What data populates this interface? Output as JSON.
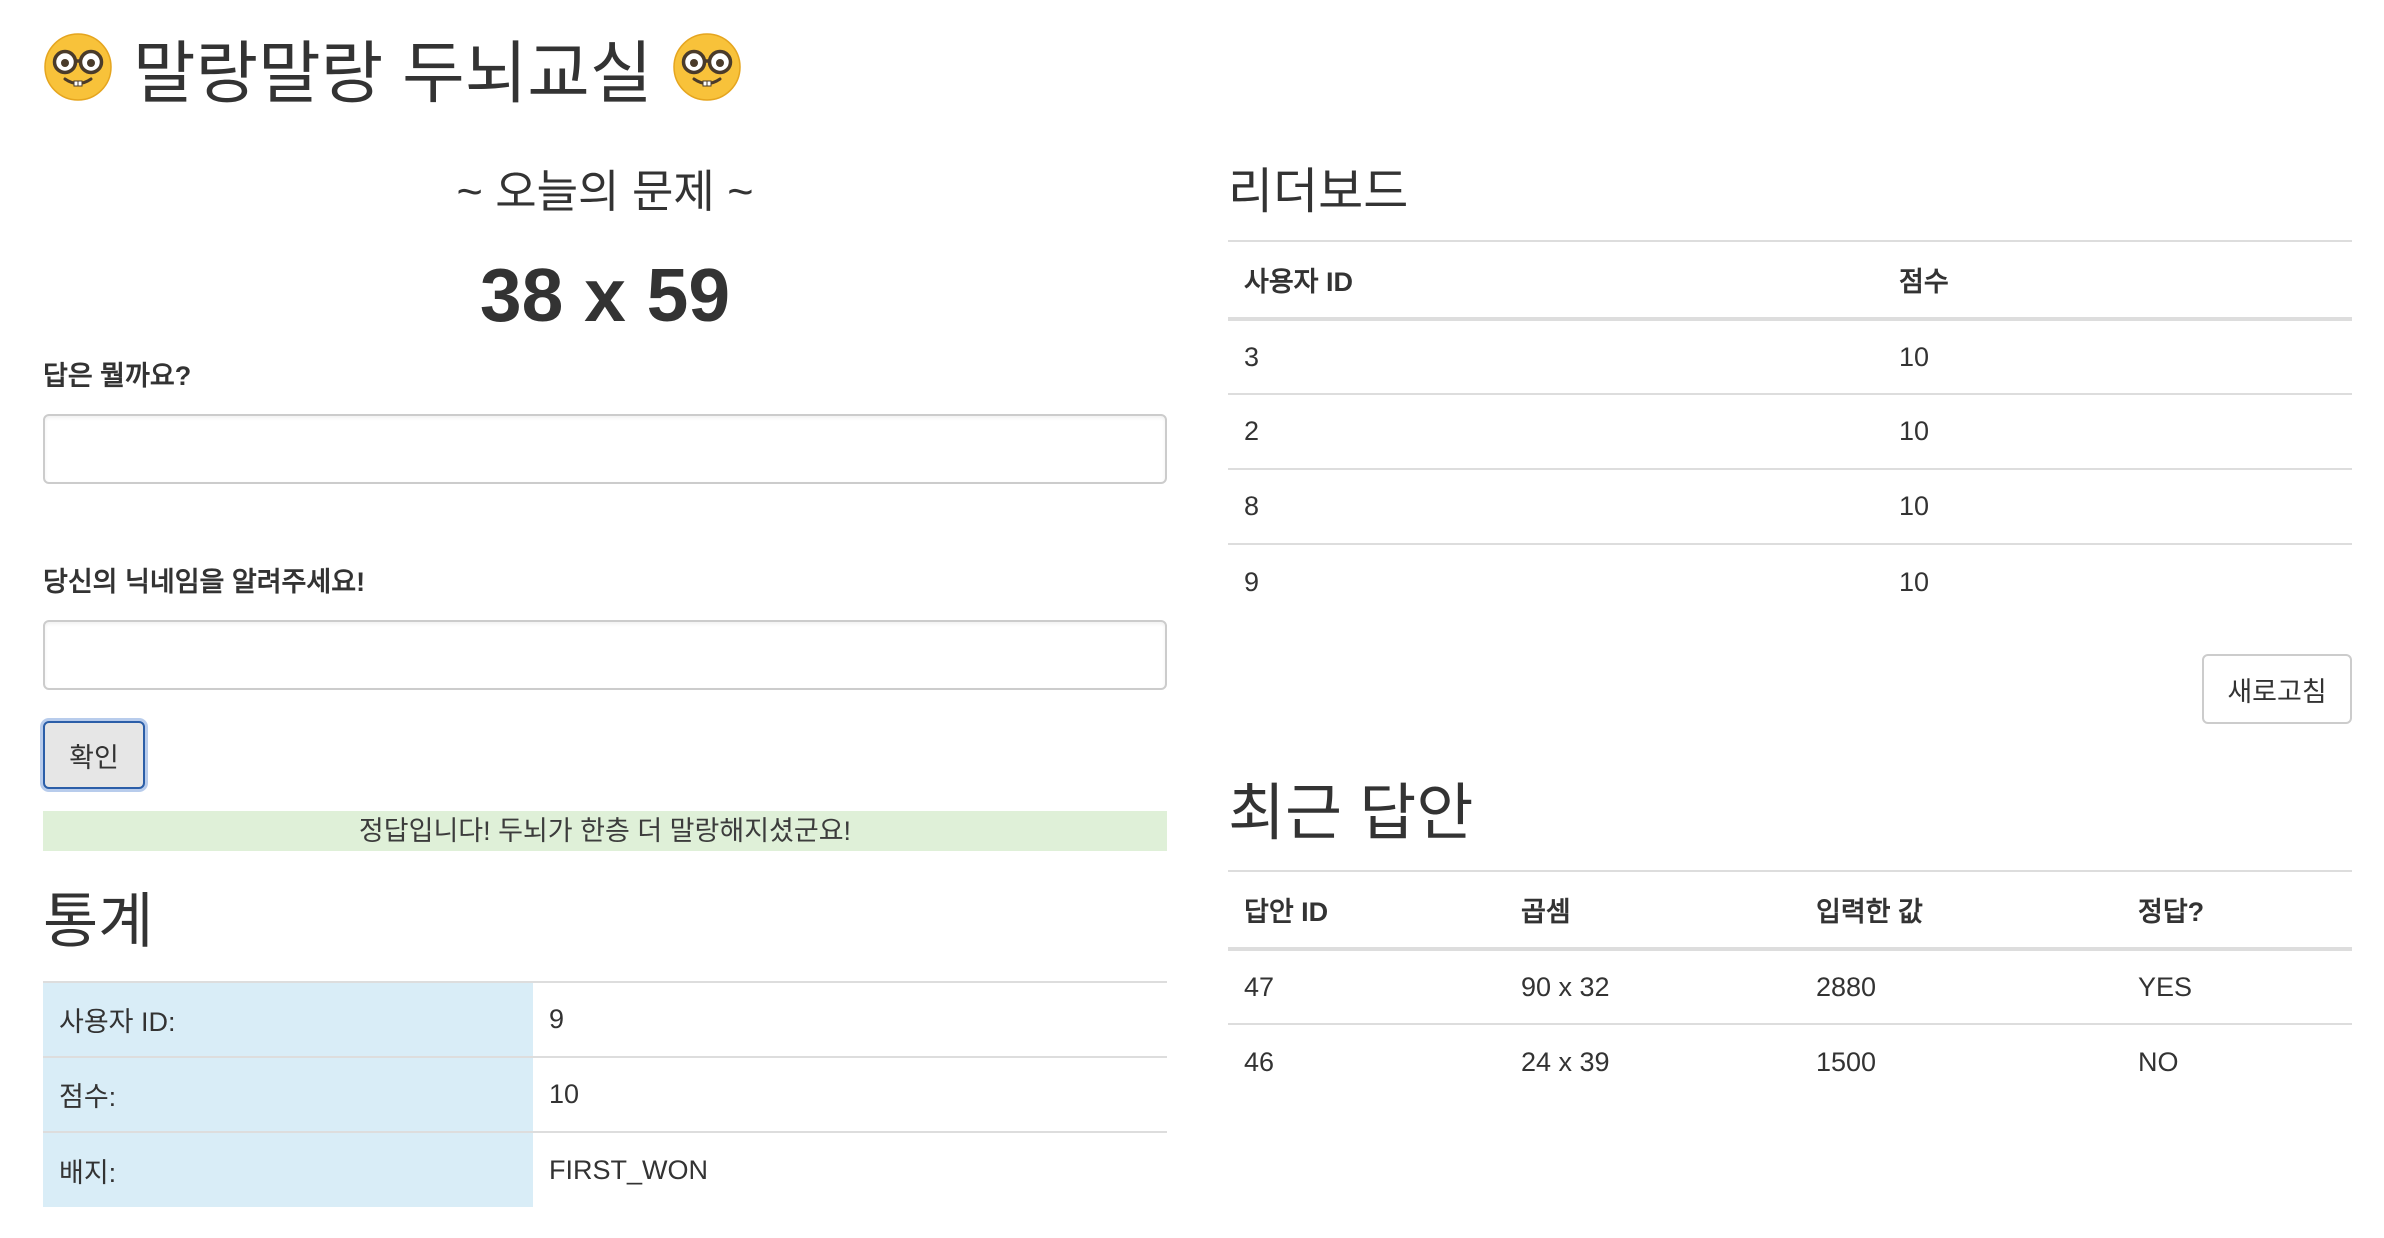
{
  "app": {
    "title": "말랑말랑 두뇌교실",
    "title_icon_left": "nerd-face-emoji",
    "title_icon_right": "nerd-face-emoji"
  },
  "problem": {
    "heading": "~ 오늘의 문제 ~",
    "expression": "38 x 59"
  },
  "form": {
    "answer_label": "답은 뭘까요?",
    "answer_value": "",
    "nickname_label": "당신의 닉네임을 알려주세요!",
    "nickname_value": "",
    "submit_label": "확인"
  },
  "result": {
    "message": "정답입니다! 두뇌가 한층 더 말랑해지셨군요!",
    "color": "#dff0d8"
  },
  "stats": {
    "heading": "통계",
    "rows": [
      {
        "key": "사용자 ID:",
        "value": "9"
      },
      {
        "key": "점수:",
        "value": "10"
      },
      {
        "key": "배지:",
        "value": "FIRST_WON"
      }
    ],
    "key_color": "#d9edf7"
  },
  "leaderboard": {
    "heading": "리더보드",
    "columns": [
      "사용자 ID",
      "점수"
    ],
    "rows": [
      [
        "3",
        "10"
      ],
      [
        "2",
        "10"
      ],
      [
        "8",
        "10"
      ],
      [
        "9",
        "10"
      ]
    ],
    "refresh_label": "새로고침"
  },
  "recent": {
    "heading": "최근 답안",
    "columns": [
      "답안 ID",
      "곱셈",
      "입력한 값",
      "정답?"
    ],
    "rows": [
      [
        "47",
        "90 x 32",
        "2880",
        "YES"
      ],
      [
        "46",
        "24 x 39",
        "1500",
        "NO"
      ]
    ]
  }
}
